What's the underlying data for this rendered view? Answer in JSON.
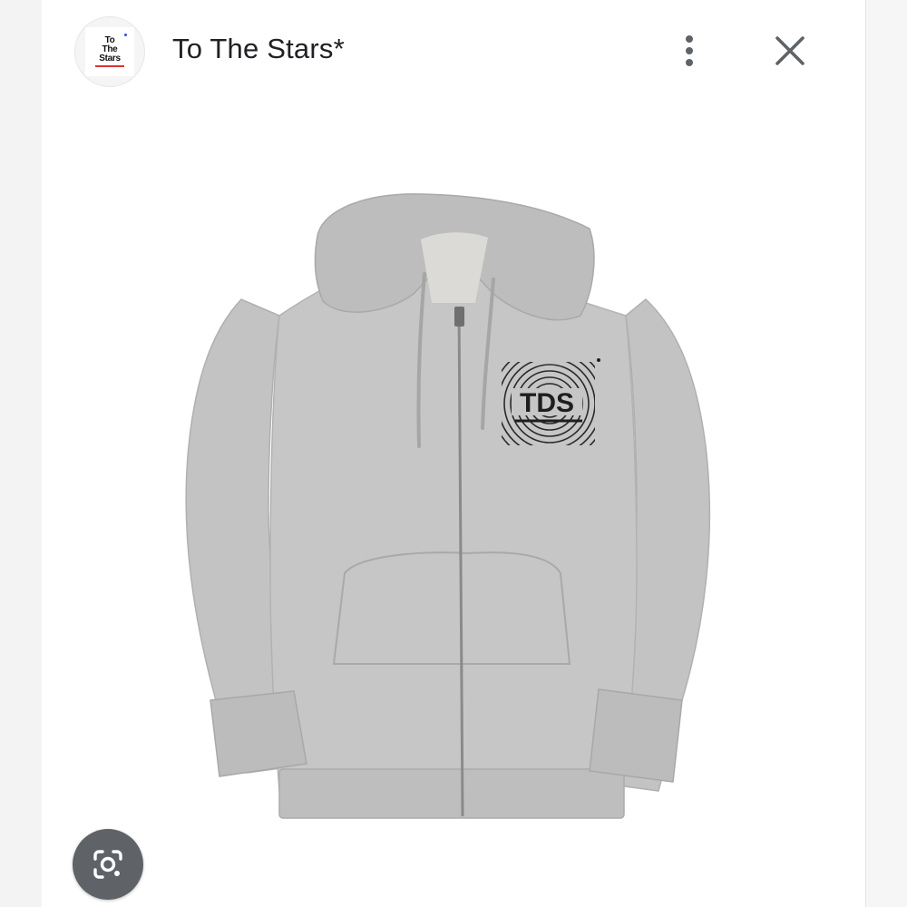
{
  "header": {
    "title": "To The Stars*",
    "logo": {
      "lines": [
        "To",
        "The",
        "Stars"
      ],
      "accent_color": "#d33a3a"
    },
    "more_icon": "more-vert-icon",
    "close_icon": "close-icon"
  },
  "image": {
    "subject": "heather-grey-zip-hoodie",
    "chest_graphic": "TDS"
  },
  "lens_button": {
    "icon": "google-lens-icon",
    "color": "#5f6368"
  }
}
